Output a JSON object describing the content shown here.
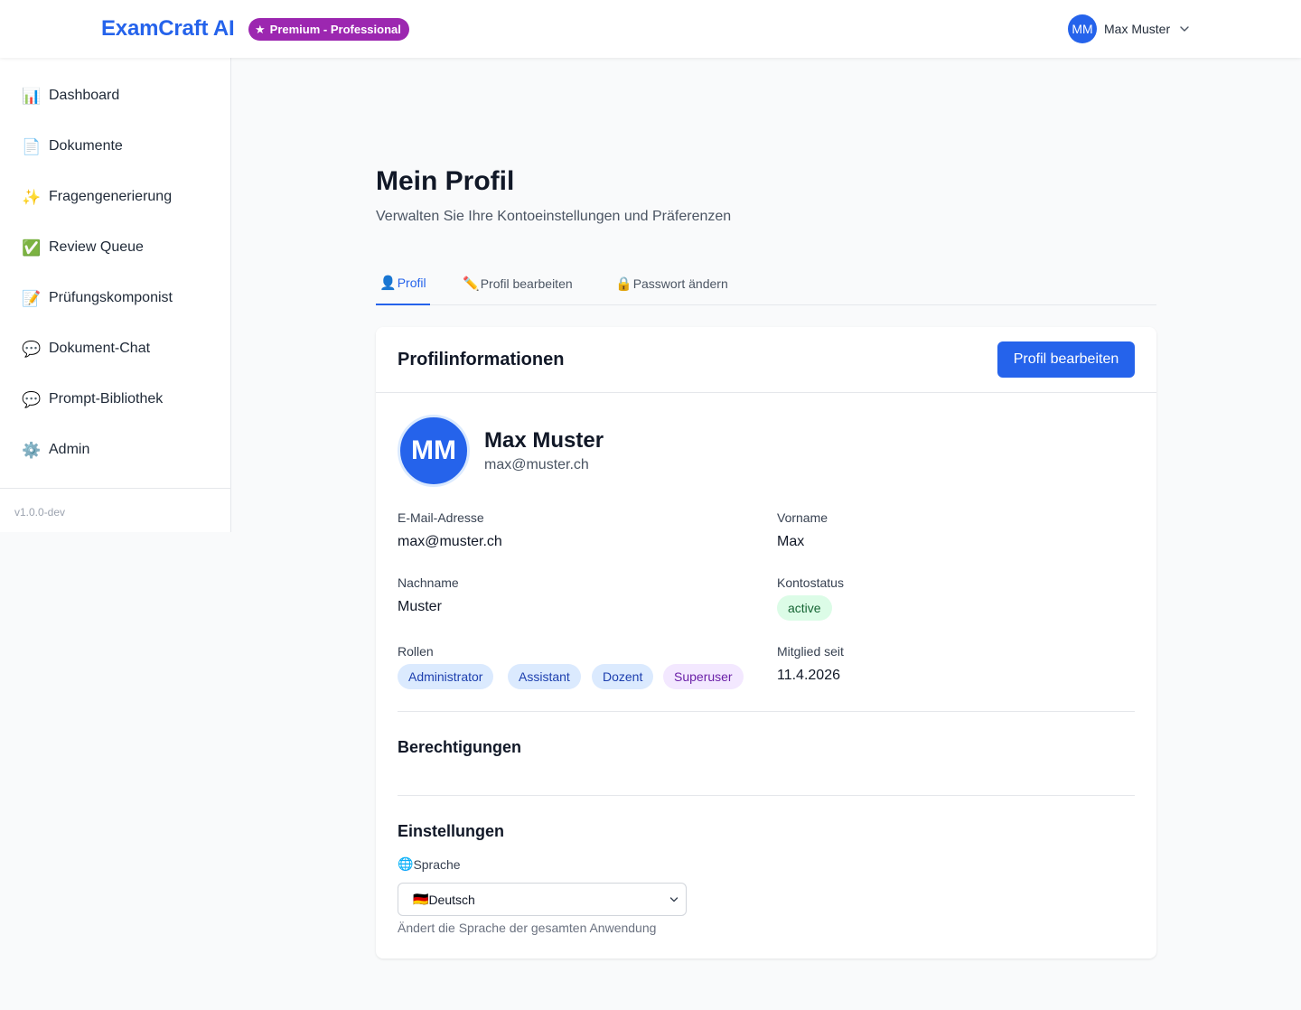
{
  "header": {
    "brand": "ExamCraft AI",
    "plan_badge": "Premium - Professional",
    "user_initials": "MM",
    "user_name": "Max Muster"
  },
  "sidebar": {
    "items": [
      {
        "icon": "bar-chart-icon",
        "glyph": "📊",
        "label": "Dashboard"
      },
      {
        "icon": "document-icon",
        "glyph": "📄",
        "label": "Dokumente"
      },
      {
        "icon": "sparkles-icon",
        "glyph": "✨",
        "label": "Fragengenerierung"
      },
      {
        "icon": "check-mark-icon",
        "glyph": "✅",
        "label": "Review Queue"
      },
      {
        "icon": "memo-icon",
        "glyph": "📝",
        "label": "Prüfungskomponist"
      },
      {
        "icon": "speech-bubble-icon",
        "glyph": "💬",
        "label": "Dokument-Chat"
      },
      {
        "icon": "speech-bubble-icon",
        "glyph": "💬",
        "label": "Prompt-Bibliothek"
      },
      {
        "icon": "gear-icon",
        "glyph": "⚙️",
        "label": "Admin"
      }
    ],
    "version": "v1.0.0-dev"
  },
  "page": {
    "title": "Mein Profil",
    "subtitle": "Verwalten Sie Ihre Kontoeinstellungen und Präferenzen"
  },
  "tabs": [
    {
      "glyph": "👤",
      "label": "Profil",
      "active": true
    },
    {
      "glyph": "✏️",
      "label": "Profil bearbeiten",
      "active": false
    },
    {
      "glyph": "🔒",
      "label": "Passwort ändern",
      "active": false
    }
  ],
  "card": {
    "title": "Profilinformationen",
    "edit_button": "Profil bearbeiten",
    "avatar_initials": "MM",
    "name": "Max Muster",
    "email": "max@muster.ch",
    "fields": {
      "email_label": "E-Mail-Adresse",
      "email_value": "max@muster.ch",
      "firstname_label": "Vorname",
      "firstname_value": "Max",
      "lastname_label": "Nachname",
      "lastname_value": "Muster",
      "status_label": "Kontostatus",
      "status_value": "active",
      "roles_label": "Rollen",
      "roles": [
        "Administrator",
        "Assistant",
        "Dozent",
        "Superuser"
      ],
      "member_since_label": "Mitglied seit",
      "member_since_value": "11.4.2026"
    },
    "permissions_title": "Berechtigungen",
    "settings_title": "Einstellungen",
    "language_glyph": "🌐",
    "language_label": "Sprache",
    "language_flag": "🇩🇪",
    "language_selected": "Deutsch",
    "language_help": "Ändert die Sprache der gesamten Anwendung"
  },
  "colors": {
    "brand": "#2563eb",
    "premium": "#9c27b0",
    "status_active_bg": "#dcfce7",
    "status_active_fg": "#166534",
    "role_blue_bg": "#dbeafe",
    "role_purple_bg": "#f3e8ff"
  }
}
